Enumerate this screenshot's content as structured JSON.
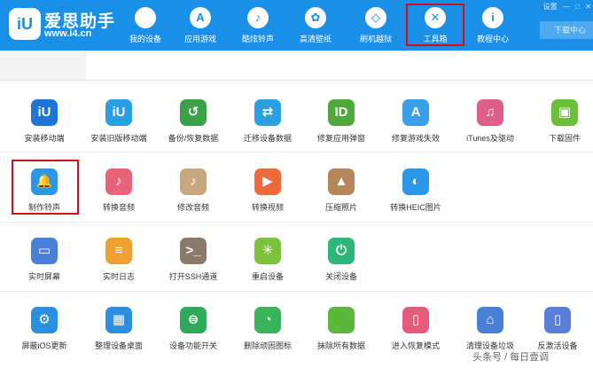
{
  "brand": {
    "logo_text": "iU",
    "name": "爱思助手",
    "url": "www.i4.cn"
  },
  "nav": [
    {
      "label": "我的设备",
      "icon": "apple-icon",
      "glyph": ""
    },
    {
      "label": "应用游戏",
      "icon": "app-store-icon",
      "glyph": "A"
    },
    {
      "label": "酷炫铃声",
      "icon": "bell-icon",
      "glyph": "♪"
    },
    {
      "label": "高清壁纸",
      "icon": "flower-icon",
      "glyph": "✿"
    },
    {
      "label": "刷机越狱",
      "icon": "dropbox-icon",
      "glyph": "◇"
    },
    {
      "label": "工具箱",
      "icon": "tools-icon",
      "glyph": "✕"
    },
    {
      "label": "教程中心",
      "icon": "info-icon",
      "glyph": "i"
    }
  ],
  "download_label": "下载中心",
  "window_controls": [
    "设置",
    "—",
    "□",
    "✕"
  ],
  "tools": [
    {
      "label": "安装移动端",
      "icon": "i4-app-icon",
      "glyph": "iU",
      "color": "#1f74d6"
    },
    {
      "label": "安装旧版移动端",
      "icon": "i4-legacy-app-icon",
      "glyph": "iU",
      "color": "#2a9fe3"
    },
    {
      "label": "备份/恢复数据",
      "icon": "backup-clock-icon",
      "glyph": "↺",
      "color": "#3aa14a"
    },
    {
      "label": "迁移设备数据",
      "icon": "migrate-data-icon",
      "glyph": "⇄",
      "color": "#2aa0e0"
    },
    {
      "label": "修复应用弹窗",
      "icon": "fix-popup-icon",
      "glyph": "ID",
      "color": "#4fa83a"
    },
    {
      "label": "修复游戏失效",
      "icon": "fix-game-icon",
      "glyph": "A",
      "color": "#3a9fe8"
    },
    {
      "label": "iTunes及驱动",
      "icon": "itunes-icon",
      "glyph": "♫",
      "color": "#e05f8a"
    },
    {
      "label": "下载固件",
      "icon": "firmware-cube-icon",
      "glyph": "▣",
      "color": "#6cbf3a"
    },
    {
      "label": "制作铃声",
      "icon": "ringtone-bell-icon",
      "glyph": "🔔",
      "color": "#2a97e8"
    },
    {
      "label": "转换音频",
      "icon": "convert-audio-icon",
      "glyph": "♪",
      "color": "#e8647a"
    },
    {
      "label": "修改音频",
      "icon": "edit-audio-icon",
      "glyph": "♪",
      "color": "#c9a77e"
    },
    {
      "label": "转换视频",
      "icon": "convert-video-icon",
      "glyph": "▶",
      "color": "#ee6a3a"
    },
    {
      "label": "压缩照片",
      "icon": "compress-photo-icon",
      "glyph": "▲",
      "color": "#b5865a"
    },
    {
      "label": "转换HEIC图片",
      "icon": "heic-convert-icon",
      "glyph": "◐",
      "color": "#2a97e8"
    },
    {
      "label": "实时屏幕",
      "icon": "live-screen-icon",
      "glyph": "▭",
      "color": "#4a7fd8"
    },
    {
      "label": "实时日志",
      "icon": "live-log-icon",
      "glyph": "≡",
      "color": "#f0a030"
    },
    {
      "label": "打开SSH通道",
      "icon": "ssh-terminal-icon",
      "glyph": ">_",
      "color": "#8a7a6a"
    },
    {
      "label": "重启设备",
      "icon": "restart-icon",
      "glyph": "✳",
      "color": "#7cc23a"
    },
    {
      "label": "关闭设备",
      "icon": "power-icon",
      "glyph": "⏻",
      "color": "#2eb57a"
    },
    {
      "label": "屏蔽iOS更新",
      "icon": "block-update-icon",
      "glyph": "⚙",
      "color": "#2a8fe0"
    },
    {
      "label": "整理设备桌面",
      "icon": "organize-desktop-icon",
      "glyph": "▦",
      "color": "#2a8fe0"
    },
    {
      "label": "设备功能开关",
      "icon": "feature-toggle-icon",
      "glyph": "⊜",
      "color": "#2eaa5a"
    },
    {
      "label": "删除顽固图标",
      "icon": "delete-icon-pie-icon",
      "glyph": "◔",
      "color": "#3ab45a"
    },
    {
      "label": "抹除所有数据",
      "icon": "erase-data-icon",
      "glyph": "",
      "color": "#5cb83a"
    },
    {
      "label": "进入恢复模式",
      "icon": "recovery-mode-icon",
      "glyph": "▯",
      "color": "#e85a7a"
    },
    {
      "label": "清理设备垃圾",
      "icon": "clean-junk-icon",
      "glyph": "⌂",
      "color": "#4a7fd8"
    },
    {
      "label": "反激活设备",
      "icon": "deactivate-icon",
      "glyph": "▯",
      "color": "#5a7fd8"
    }
  ],
  "watermark": "头条号 / 每日壹调"
}
